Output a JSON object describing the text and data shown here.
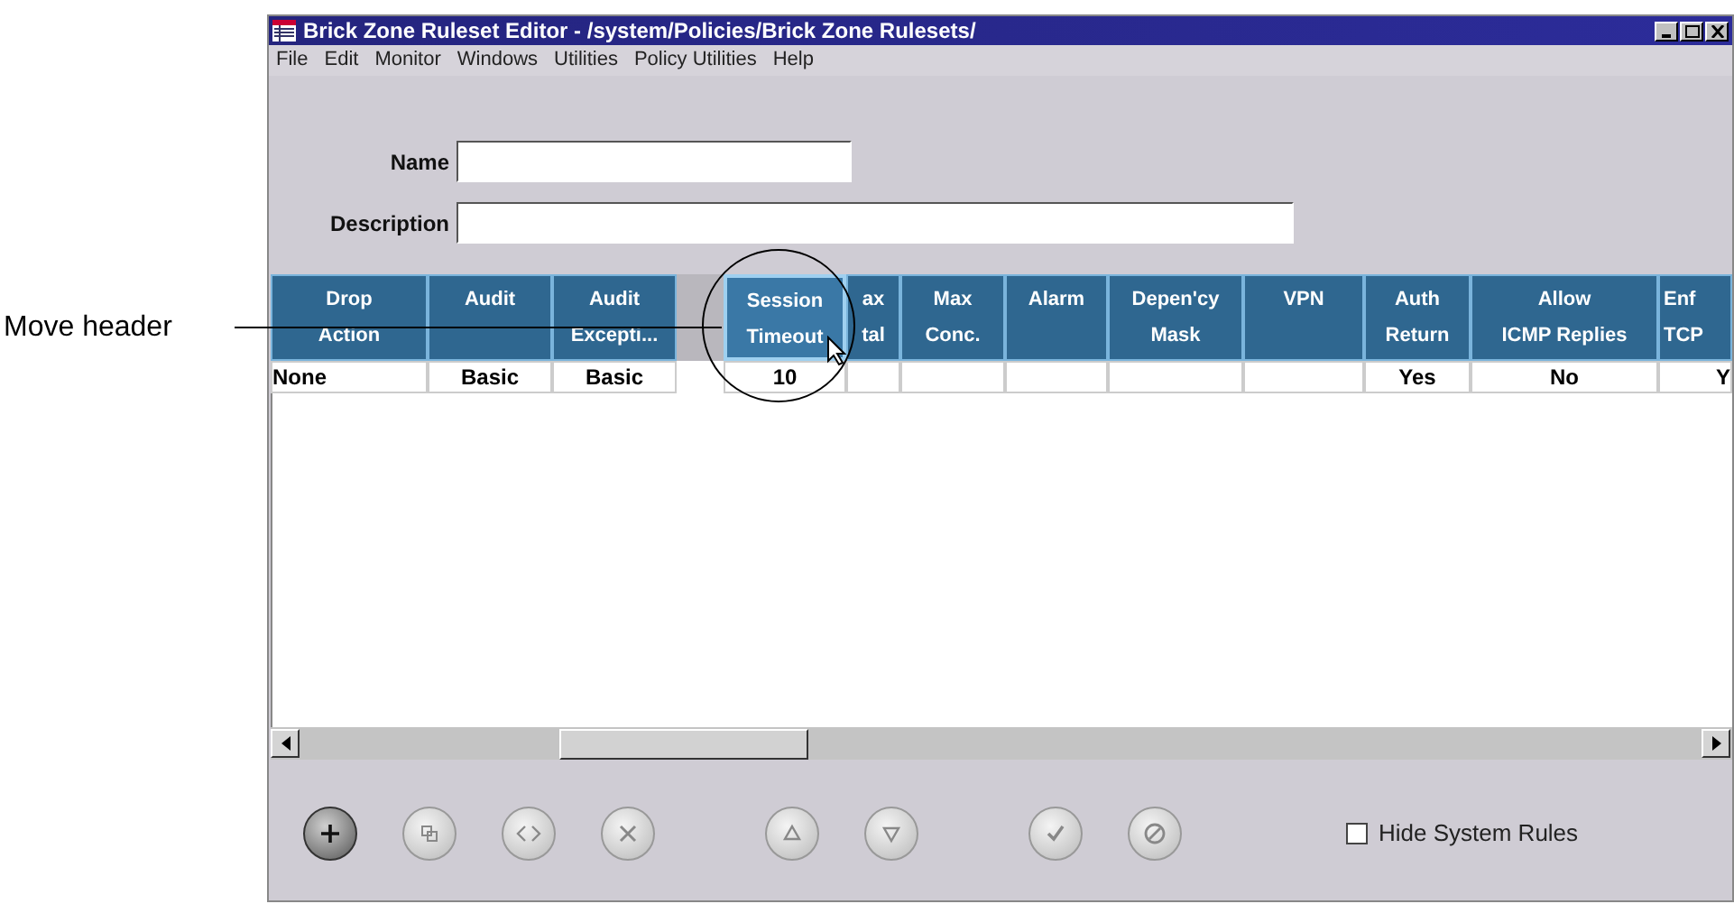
{
  "annotation": {
    "label": "Move header"
  },
  "window": {
    "title": "Brick Zone Ruleset Editor - /system/Policies/Brick Zone Rulesets/"
  },
  "menu": [
    "File",
    "Edit",
    "Monitor",
    "Windows",
    "Utilities",
    "Policy Utilities",
    "Help"
  ],
  "form": [
    {
      "label": "Name"
    },
    {
      "label": "Description"
    }
  ],
  "table": {
    "columns": [
      {
        "lines": [
          "Drop",
          "Action"
        ],
        "dragging": false
      },
      {
        "lines": [
          "Audit"
        ],
        "dragging": false
      },
      {
        "lines": [
          "Audit",
          "Excepti..."
        ],
        "dragging": false
      },
      {
        "lines": [
          "Session",
          "Timeout"
        ],
        "dragging": true
      },
      {
        "lines": [
          "ax",
          "tal"
        ],
        "dragging": false
      },
      {
        "lines": [
          "Max",
          "Conc."
        ],
        "dragging": false
      },
      {
        "lines": [
          "Alarm"
        ],
        "dragging": false
      },
      {
        "lines": [
          "Depen'cy",
          "Mask"
        ],
        "dragging": false
      },
      {
        "lines": [
          "VPN"
        ],
        "dragging": false
      },
      {
        "lines": [
          "Auth",
          "Return"
        ],
        "dragging": false
      },
      {
        "lines": [
          "Allow",
          "ICMP Replies"
        ],
        "dragging": false
      },
      {
        "lines": [
          "Enf",
          "TCP"
        ],
        "dragging": false
      }
    ],
    "rows": [
      [
        "None",
        "Basic",
        "Basic",
        "10",
        "",
        "",
        "",
        "",
        "",
        "Yes",
        "No",
        "Y"
      ]
    ]
  },
  "toolbar": [
    {
      "kind": "add",
      "disabled": false
    },
    {
      "kind": "copy",
      "disabled": true
    },
    {
      "kind": "move",
      "disabled": true
    },
    {
      "kind": "delete",
      "disabled": true
    },
    {
      "kind": "up",
      "disabled": true
    },
    {
      "kind": "down",
      "disabled": true
    },
    {
      "kind": "apply",
      "disabled": true
    },
    {
      "kind": "cancel",
      "disabled": true
    }
  ],
  "hide_system_rules": {
    "label": "Hide System Rules",
    "checked": false
  }
}
